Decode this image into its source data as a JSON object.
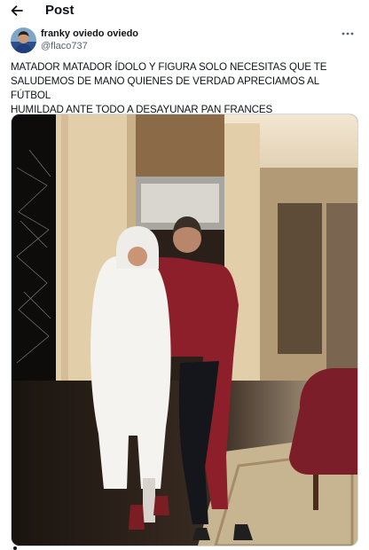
{
  "header": {
    "title": "Post",
    "back_icon": "arrow-left-icon"
  },
  "author": {
    "display_name": "franky oviedo oviedo",
    "handle": "@flaco737",
    "more_icon": "more-horizontal-icon"
  },
  "post": {
    "text_lines": [
      "MATADOR MATADOR ÍDOLO Y FIGURA SOLO NECESITAS QUE TE",
      "SALUDEMOS DE MANO QUIENES DE VERDAD APRECIAMOS AL FÚTBOL",
      "HUMILDAD ANTE TODO A DESAYUNAR PAN FRANCES"
    ]
  },
  "media": {
    "kind": "photo"
  },
  "colors": {
    "text": "#0f1419",
    "secondary": "#536471",
    "border": "#cfd9de"
  }
}
